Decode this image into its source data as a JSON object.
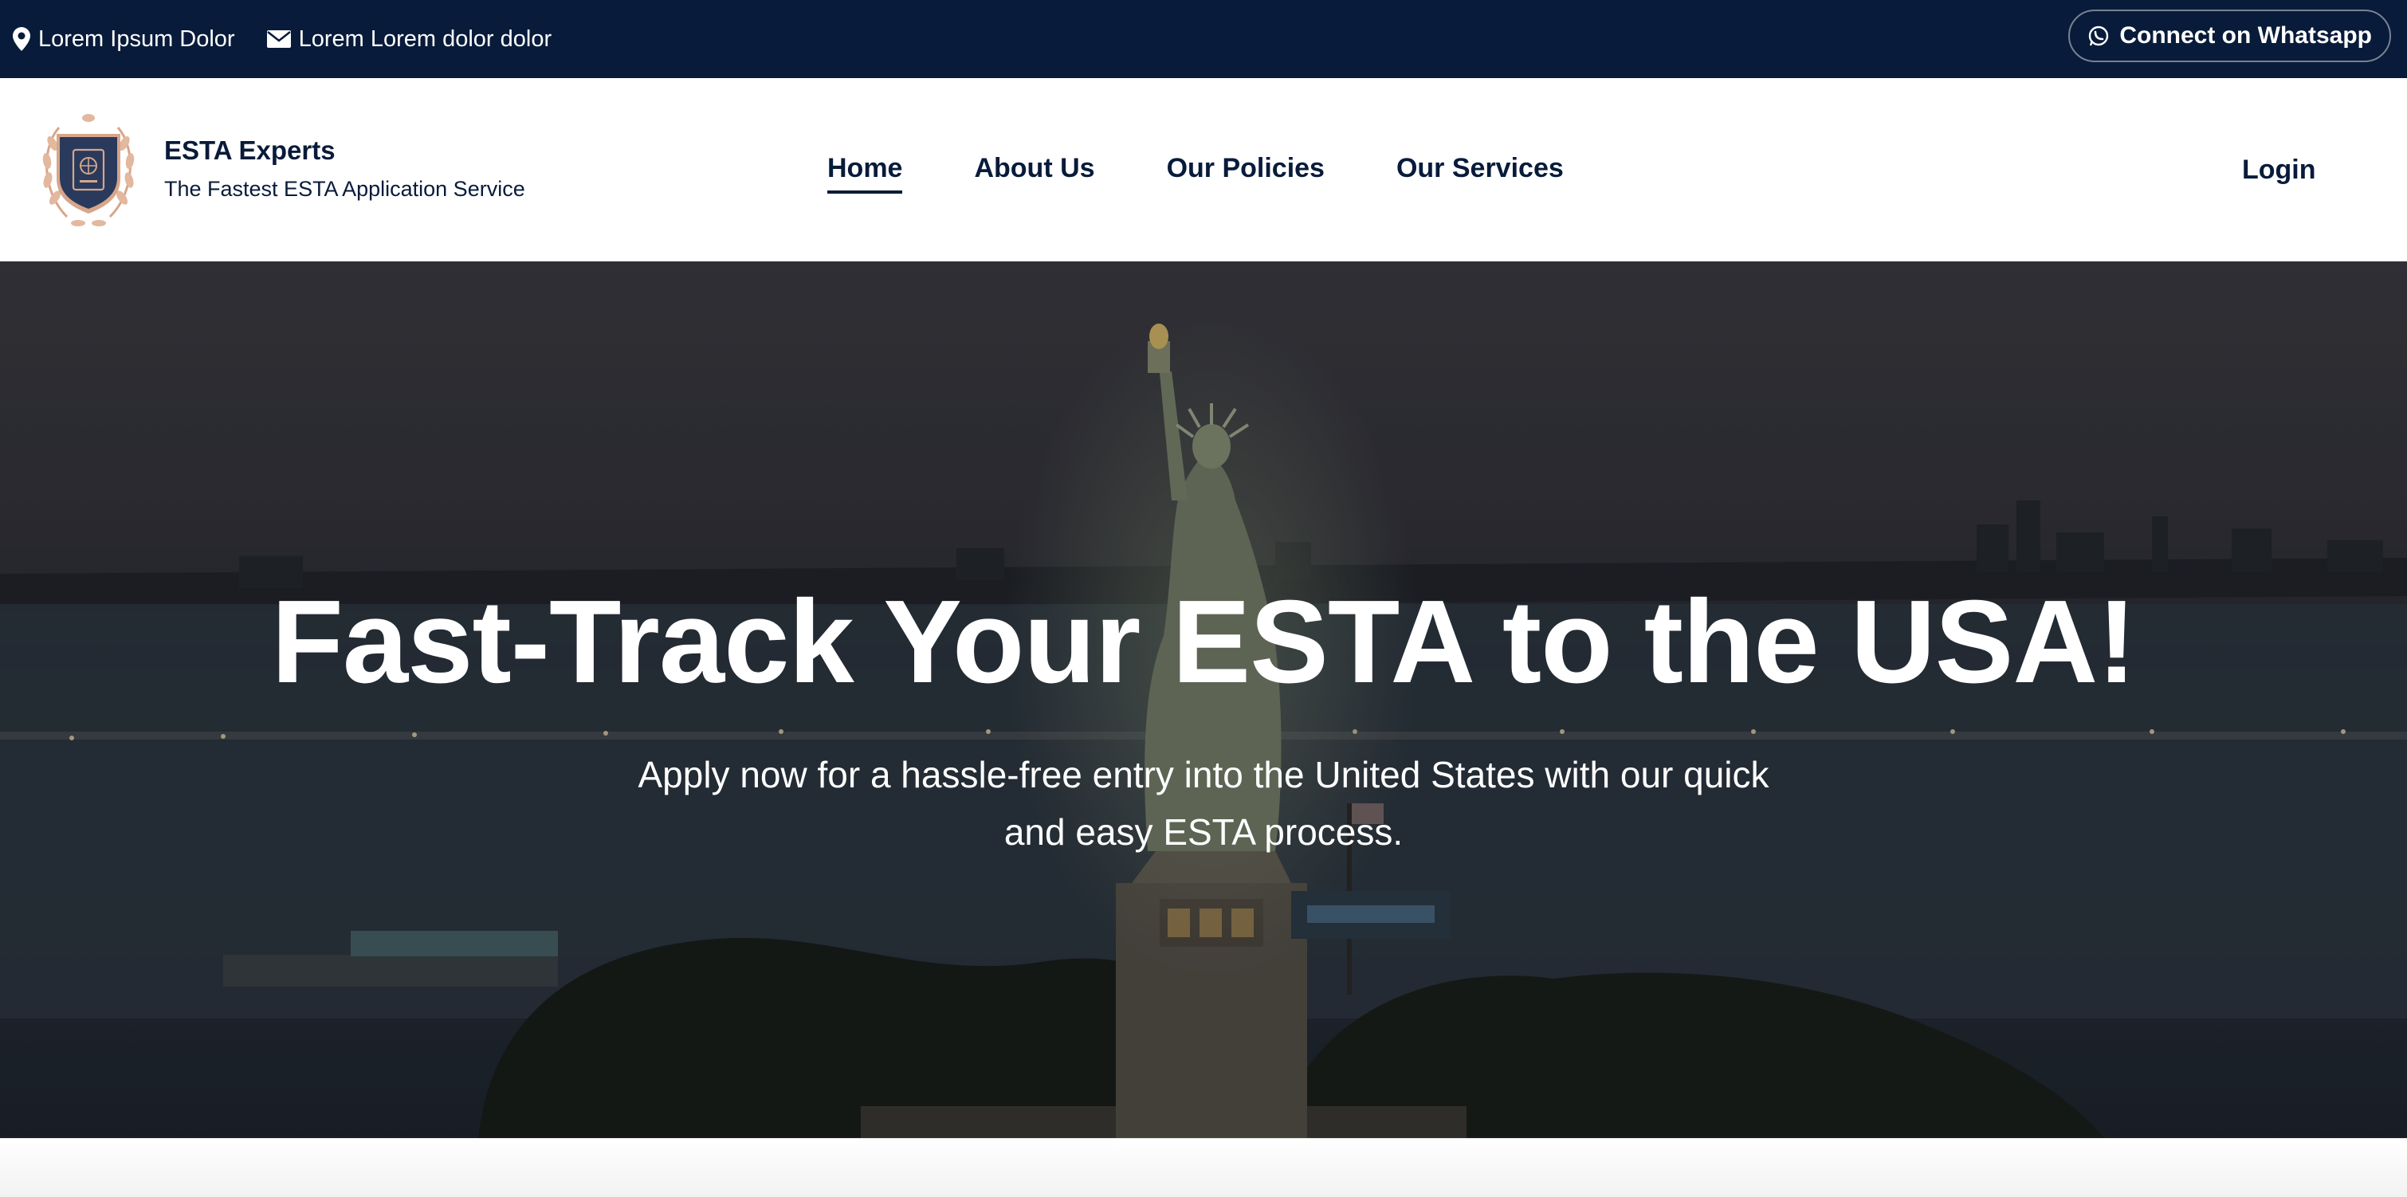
{
  "topbar": {
    "address_text": "Lorem Ipsum Dolor",
    "email_text": "Lorem Lorem dolor dolor",
    "whatsapp_label": "Connect on Whatsapp"
  },
  "header": {
    "brand_name": "ESTA Experts",
    "brand_tagline": "The Fastest ESTA Application Service",
    "nav": [
      "Home",
      "About Us",
      "Our Policies",
      "Our Services"
    ],
    "active_nav": "Home",
    "login_label": "Login"
  },
  "hero": {
    "title": "Fast-Track Your ESTA to the USA!",
    "subtitle": "Apply now for a hassle-free entry into the United States with our quick and easy ESTA process."
  },
  "colors": {
    "navy": "#081b3a",
    "white": "#ffffff"
  },
  "icons": [
    "map-pin-icon",
    "envelope-icon",
    "whatsapp-icon",
    "shield-logo-icon"
  ]
}
